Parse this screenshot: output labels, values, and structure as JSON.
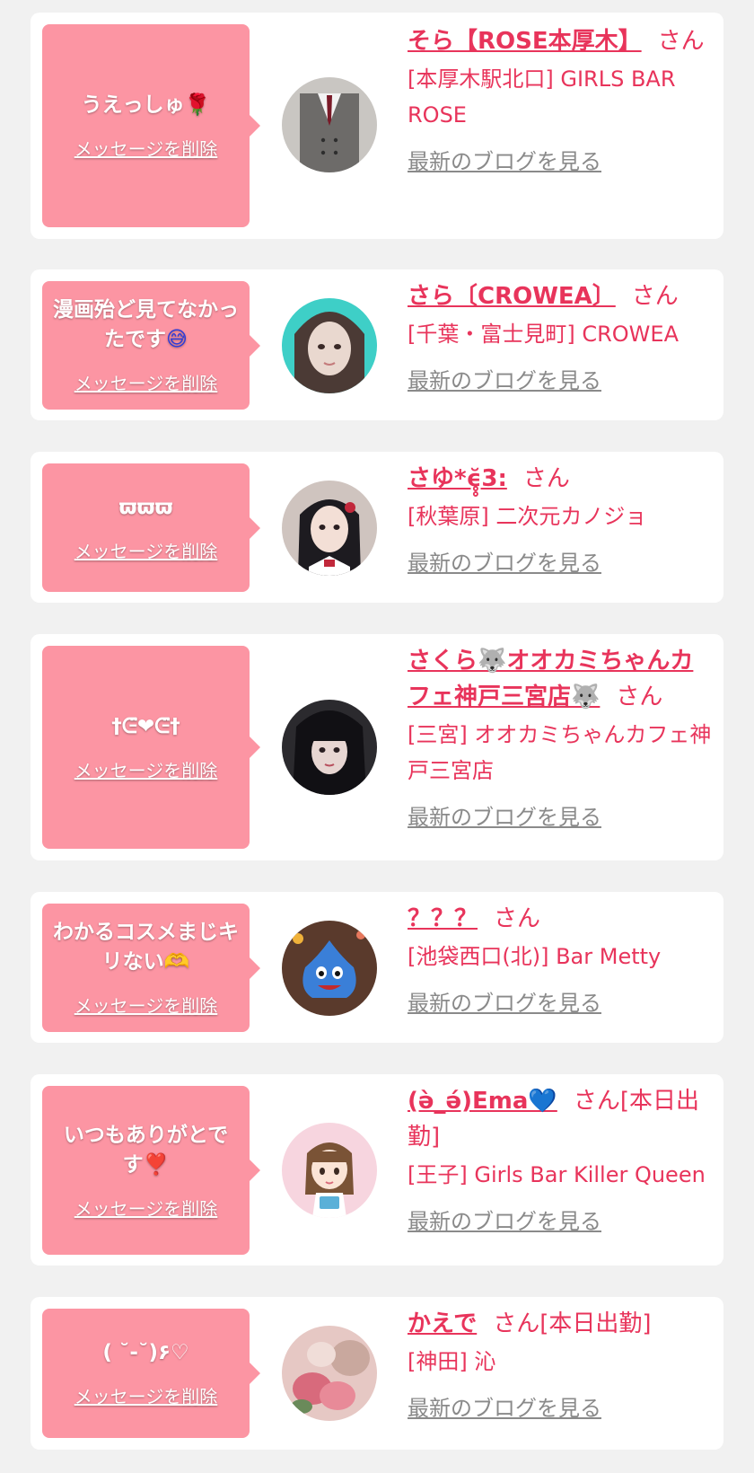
{
  "delete_label": "メッセージを削除",
  "blog_label": "最新のブログを見る",
  "san": "さん",
  "cards": [
    {
      "message": "うえっしゅ",
      "message_emoji": "🌹",
      "name": "そら【ROSE本厚木】",
      "name_suffix": "",
      "shop": "[本厚木駅北口] GIRLS BAR ROSE",
      "avatar": "man-in-gray-suit"
    },
    {
      "message": "漫画殆ど見てなかったです",
      "message_emoji": "😅",
      "name": "さら〔CROWEA〕",
      "name_suffix": "",
      "shop": "[千葉・富士見町] CROWEA",
      "avatar": "girl-on-teal"
    },
    {
      "message": "ϖϖϖ",
      "message_emoji": "",
      "name": "さゆ*ϵ̥̥̆3:",
      "name_suffix": "",
      "shop": "[秋葉原] 二次元カノジョ",
      "avatar": "girl-maid"
    },
    {
      "message": "†ᕮ̈❤ᕮ̈†",
      "message_emoji": "",
      "name": "さくら🐺オオカミちゃんカフェ神戸三宮店🐺",
      "name_suffix": "",
      "shop": "[三宮] オオカミちゃんカフェ神戸三宮店",
      "avatar": "girl-dark-hair"
    },
    {
      "message": "わかるコスメまじキリない",
      "message_emoji": "🫶",
      "name": "？？？",
      "name_suffix": "",
      "shop": "[池袋西口(北)] Bar Metty",
      "avatar": "blue-slime"
    },
    {
      "message": "いつもありがとです",
      "message_emoji": "❣️",
      "name": "(ə̀_ə́)Ema💙",
      "name_suffix": "[本日出勤]",
      "shop": "[王子] Girls Bar Killer Queen",
      "avatar": "cartoon-girl"
    },
    {
      "message": "( ˘-˘)۶♡",
      "message_emoji": "",
      "name": "かえで",
      "name_suffix": "[本日出勤]",
      "shop": "[神田] 沁",
      "avatar": "flowers-blur"
    }
  ]
}
